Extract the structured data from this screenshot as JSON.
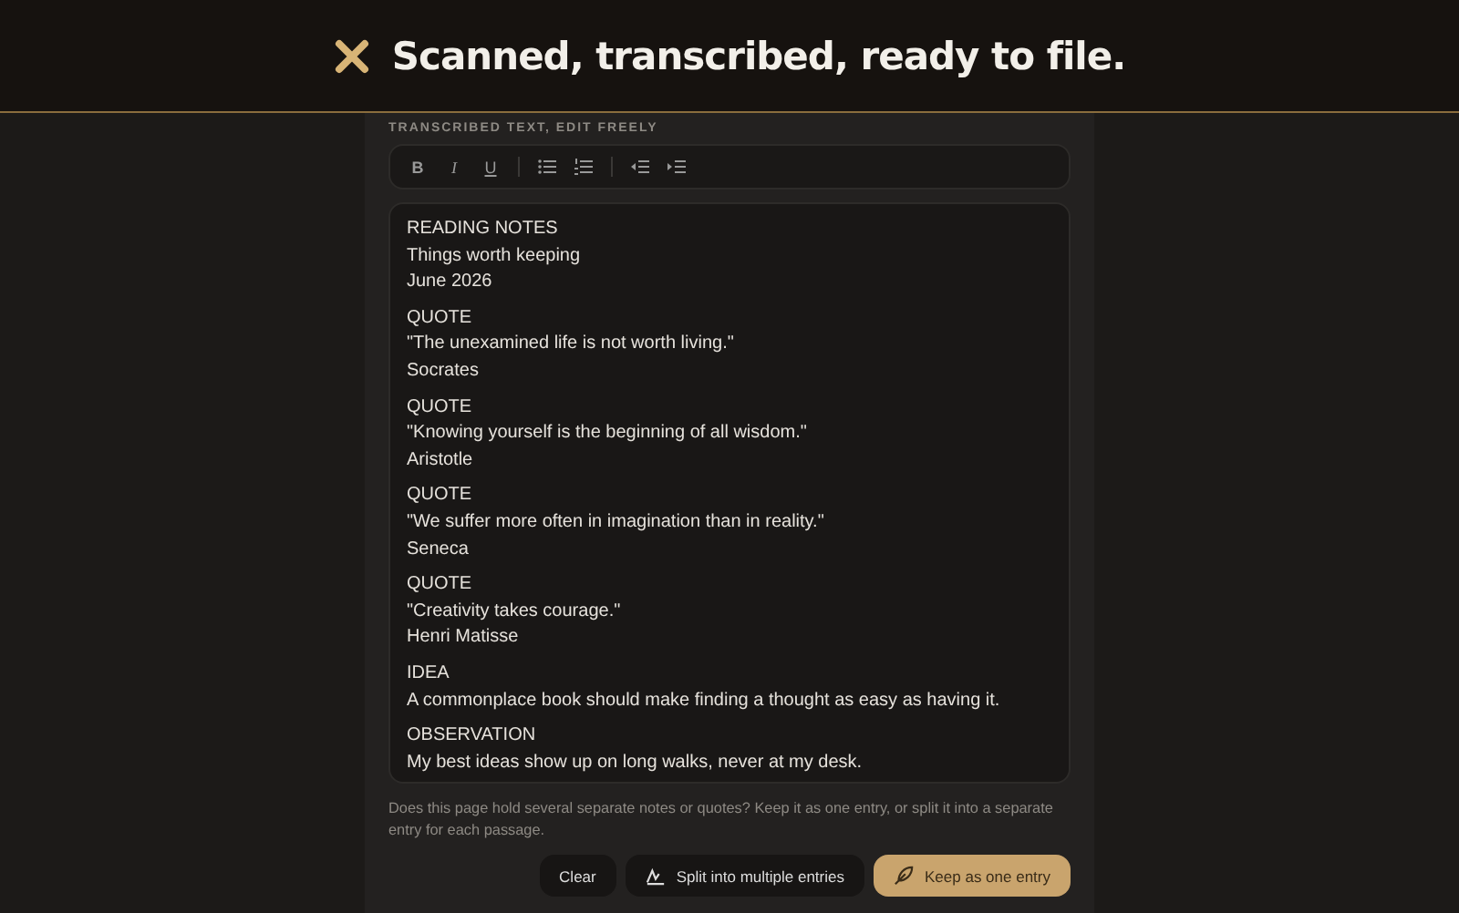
{
  "header": {
    "title": "Scanned, transcribed, ready to file."
  },
  "editor": {
    "label": "TRANSCRIBED TEXT, EDIT FREELY",
    "toolbar": [
      {
        "kind": "bold",
        "label": "B"
      },
      {
        "kind": "italic",
        "label": "I"
      },
      {
        "kind": "underline",
        "label": "U"
      },
      {
        "kind": "separator"
      },
      {
        "kind": "bullets"
      },
      {
        "kind": "numbers"
      },
      {
        "kind": "separator"
      },
      {
        "kind": "outdent"
      },
      {
        "kind": "indent"
      }
    ],
    "paragraphs": [
      [
        "READING NOTES",
        "Things worth keeping",
        "June 2026"
      ],
      [
        "QUOTE",
        "\"The unexamined life is not worth living.\"",
        "Socrates"
      ],
      [
        "QUOTE",
        "\"Knowing yourself is the beginning of all wisdom.\"",
        "Aristotle"
      ],
      [
        "QUOTE",
        "\"We suffer more often in imagination than in reality.\"",
        "Seneca"
      ],
      [
        "QUOTE",
        "\"Creativity takes courage.\"",
        "Henri Matisse"
      ],
      [
        "IDEA",
        "A commonplace book should make finding a thought as easy as having it."
      ],
      [
        "OBSERVATION",
        "My best ideas show up on long walks, never at my desk."
      ]
    ]
  },
  "help": "Does this page hold several separate notes or quotes? Keep it as one entry, or split it into a separate entry for each passage.",
  "buttons": [
    {
      "kind": "plain",
      "label": "Clear"
    },
    {
      "kind": "split",
      "label": "Split into multiple entries"
    },
    {
      "kind": "primary",
      "label": "Keep as one entry"
    }
  ]
}
